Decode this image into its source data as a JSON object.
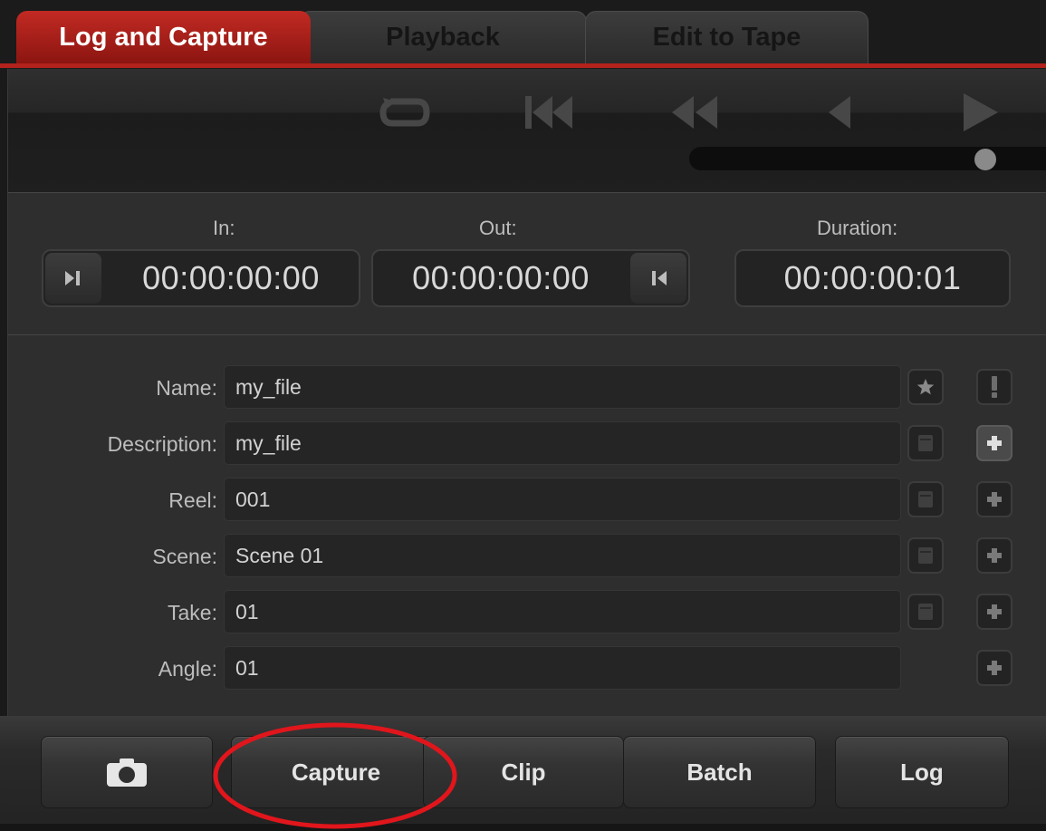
{
  "tabs": [
    {
      "label": "Log and Capture",
      "active": true
    },
    {
      "label": "Playback",
      "active": false
    },
    {
      "label": "Edit to Tape",
      "active": false
    }
  ],
  "transport": {
    "buttons": [
      "loop-icon",
      "go-to-start-icon",
      "rewind-icon",
      "step-back-icon",
      "play-icon"
    ],
    "scrub_position": 0.85
  },
  "timecode": {
    "in_label": "In:",
    "in_value": "00:00:00:00",
    "out_label": "Out:",
    "out_value": "00:00:00:00",
    "duration_label": "Duration:",
    "duration_value": "00:00:00:01"
  },
  "metadata": {
    "name": {
      "label": "Name:",
      "value": "my_file"
    },
    "description": {
      "label": "Description:",
      "value": "my_file"
    },
    "reel": {
      "label": "Reel:",
      "value": "001"
    },
    "scene": {
      "label": "Scene:",
      "value": "Scene 01"
    },
    "take": {
      "label": "Take:",
      "value": "01"
    },
    "angle": {
      "label": "Angle:",
      "value": "01"
    }
  },
  "bottom": {
    "capture_label": "Capture",
    "clip_label": "Clip",
    "batch_label": "Batch",
    "log_label": "Log"
  },
  "colors": {
    "accent": "#b3221c",
    "annotation": "#e0161c",
    "background": "#2e2e2e"
  }
}
